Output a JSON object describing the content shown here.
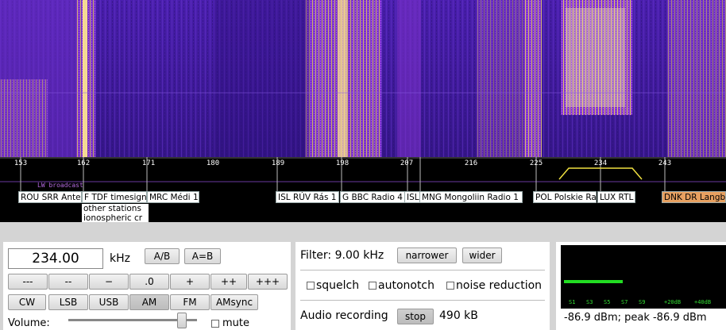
{
  "waterfall": {
    "description_colors": {
      "background": "#3a1a9a",
      "hot": "#ffee88",
      "mid": "#c060ff"
    }
  },
  "scale": {
    "ticks": [
      "153",
      "162",
      "171",
      "180",
      "189",
      "198",
      "207",
      "216",
      "225",
      "234",
      "243"
    ],
    "band_label": "LW broadcast"
  },
  "stations": [
    {
      "label": "ROU SRR Antena",
      "orange": false
    },
    {
      "label": "F TDF timesign",
      "orange": false
    },
    {
      "label": "MRC Médi 1",
      "orange": false
    },
    {
      "label": "ISL RÚV Rás 1",
      "orange": false
    },
    {
      "label": "G BBC Radio 4",
      "orange": false
    },
    {
      "label": "ISL",
      "orange": false
    },
    {
      "label": "MNG Mongoliin Radio 1",
      "orange": false
    },
    {
      "label": "POL Polskie Radio",
      "orange": false
    },
    {
      "label": "LUX RTL",
      "orange": false
    },
    {
      "label": "DNK DR Langbølge",
      "orange": true
    }
  ],
  "stack_lines": [
    "other stations",
    "ionospheric cr"
  ],
  "frequency": {
    "value": "234.00",
    "unit": "kHz",
    "ab_label": "A/B",
    "aeqb_label": "A=B"
  },
  "step_buttons": [
    "---",
    "--",
    "−",
    ".0",
    "+",
    "++",
    "+++"
  ],
  "mode_buttons": [
    "CW",
    "LSB",
    "USB",
    "AM",
    "FM",
    "AMsync"
  ],
  "active_mode": "AM",
  "volume": {
    "label": "Volume:",
    "level": 0.88,
    "mute_label": "mute"
  },
  "filter": {
    "label": "Filter: 9.00 kHz",
    "narrower_label": "narrower",
    "wider_label": "wider",
    "squelch_label": "squelch",
    "autonotch_label": "autonotch",
    "noise_label": "noise reduction"
  },
  "recording": {
    "label": "Audio recording",
    "stop_label": "stop",
    "size": "490 kB"
  },
  "smeter": {
    "ticks": [
      "S1",
      "S3",
      "S5",
      "S7",
      "S9",
      "+20dB",
      "+40dB"
    ],
    "level_fraction": 0.37,
    "readout": "-86.9 dBm; peak  -86.9 dBm"
  }
}
